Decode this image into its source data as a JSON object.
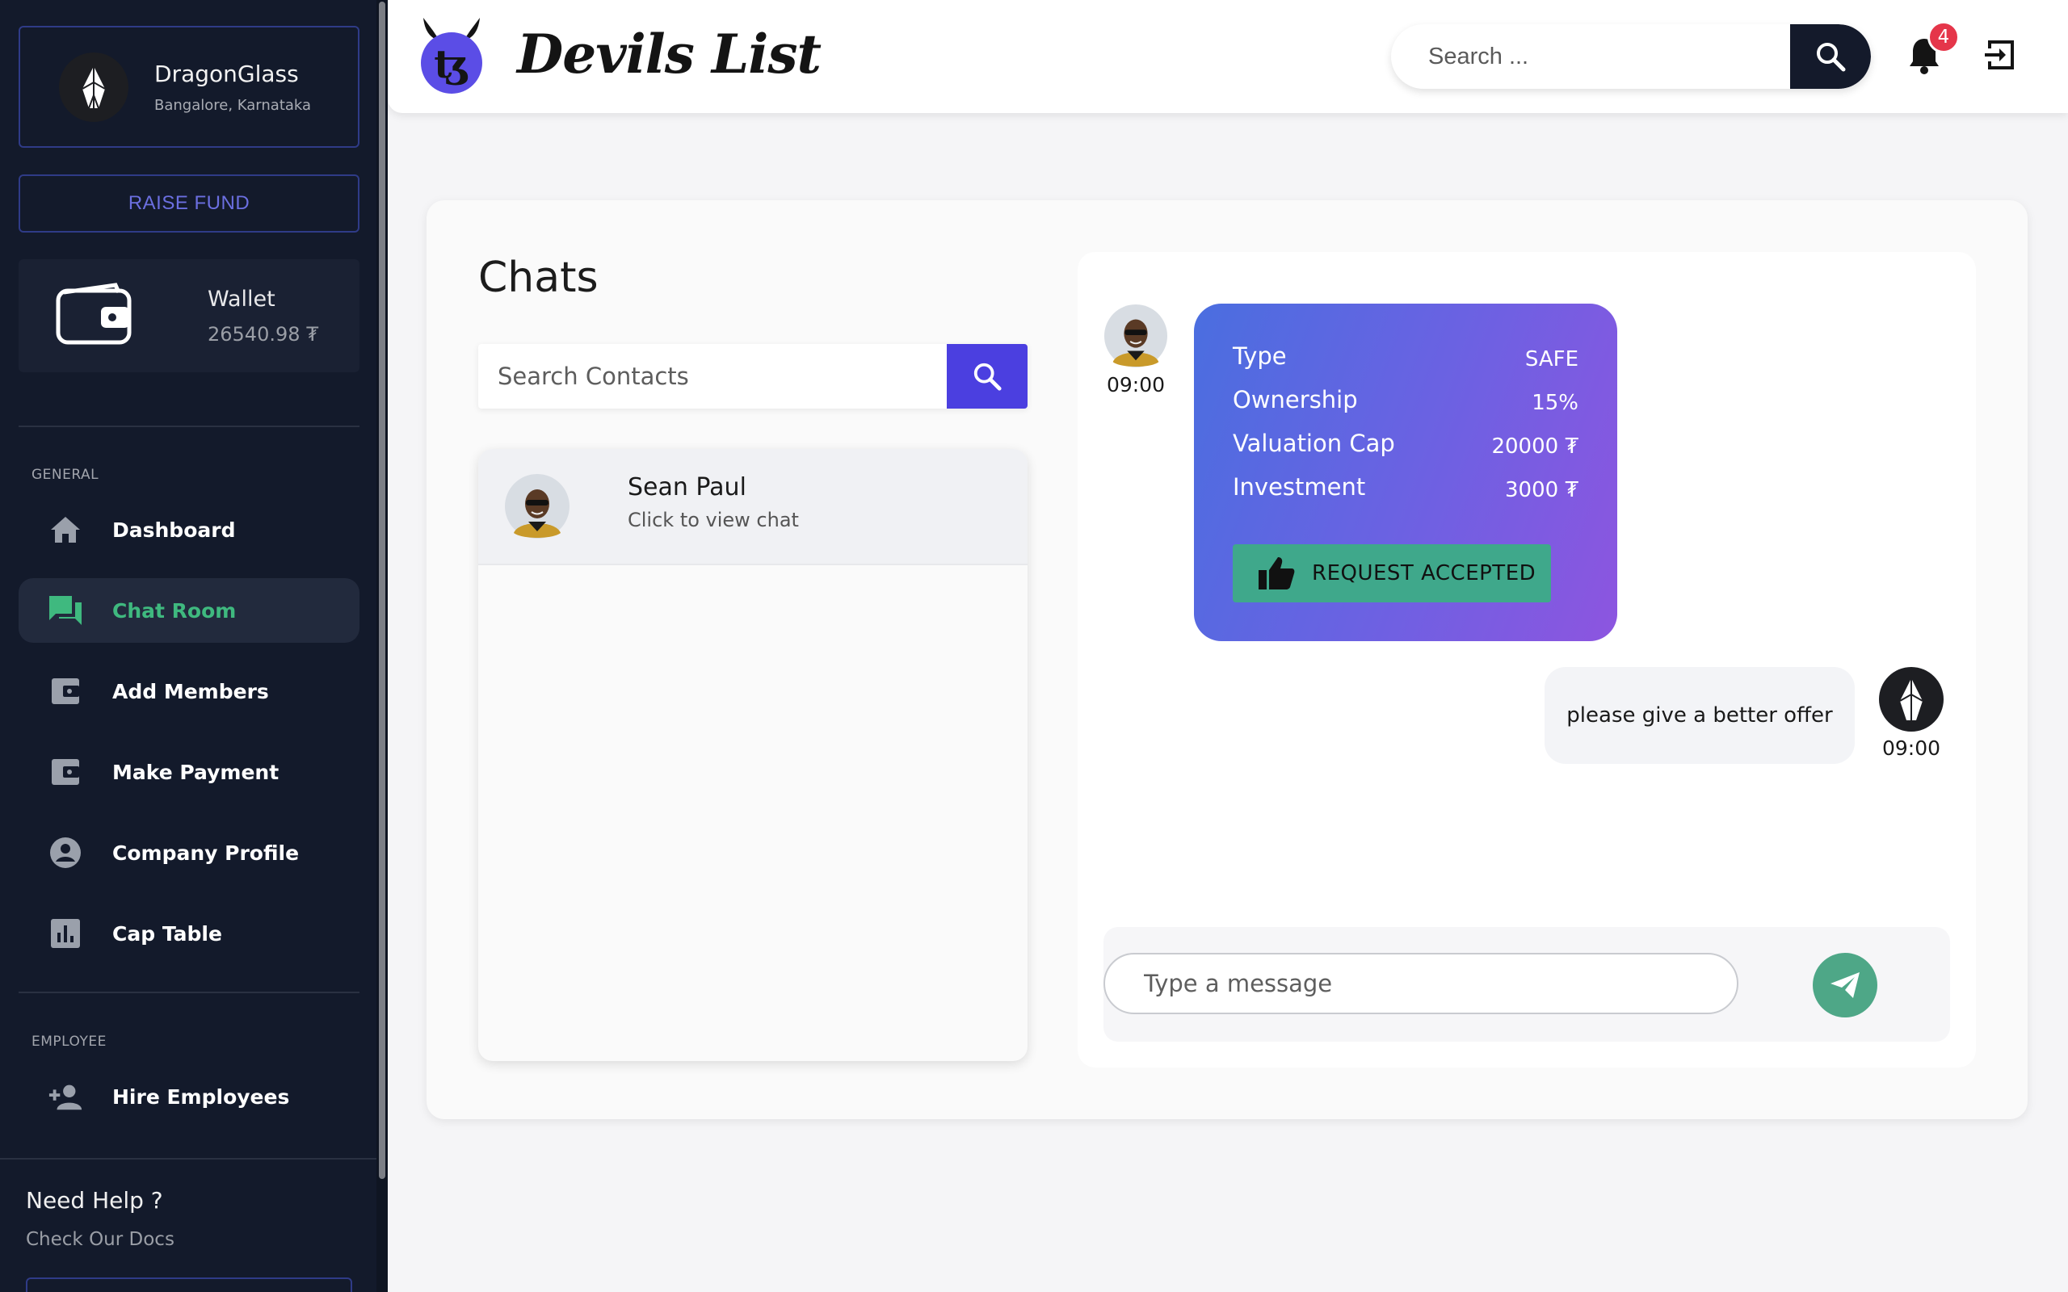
{
  "sidebar": {
    "company": {
      "name": "DragonGlass",
      "location": "Bangalore, Karnataka",
      "logo_icon": "crystal-logo-icon"
    },
    "raise_fund_label": "RAISE FUND",
    "wallet": {
      "title": "Wallet",
      "balance": "26540.98 ₮",
      "icon": "wallet-icon"
    },
    "general_label": "GENERAL",
    "items": [
      {
        "label": "Dashboard",
        "icon": "home-icon"
      },
      {
        "label": "Chat Room",
        "icon": "chat-icon",
        "active": true
      },
      {
        "label": "Add Members",
        "icon": "wallet-card-icon"
      },
      {
        "label": "Make Payment",
        "icon": "wallet-card-icon"
      },
      {
        "label": "Company Profile",
        "icon": "account-circle-icon"
      },
      {
        "label": "Cap Table",
        "icon": "bar-chart-icon"
      }
    ],
    "employee_label": "EMPLOYEE",
    "employee_items": [
      {
        "label": "Hire Employees",
        "icon": "person-add-icon"
      }
    ],
    "help": {
      "title": "Need Help ?",
      "link": "Check Our Docs"
    }
  },
  "header": {
    "brand": "Devils List",
    "search_placeholder": "Search ...",
    "notification_count": "4"
  },
  "chats": {
    "title": "Chats",
    "search_placeholder": "Search Contacts",
    "contacts": [
      {
        "name": "Sean Paul",
        "subtitle": "Click to view chat"
      }
    ]
  },
  "conversation": {
    "offer": {
      "time": "09:00",
      "rows": [
        {
          "key": "Type",
          "value": "SAFE"
        },
        {
          "key": "Ownership",
          "value": "15%"
        },
        {
          "key": "Valuation Cap",
          "value": "20000 ₮"
        },
        {
          "key": "Investment",
          "value": "3000 ₮"
        }
      ],
      "status_label": "REQUEST ACCEPTED"
    },
    "reply": {
      "text": "please give a better offer",
      "time": "09:00"
    },
    "composer_placeholder": "Type a message"
  },
  "colors": {
    "sidebar_bg": "#131a2b",
    "accent_blue": "#4b3fe0",
    "accent_green": "#3fb97f",
    "badge_red": "#e5364a"
  }
}
